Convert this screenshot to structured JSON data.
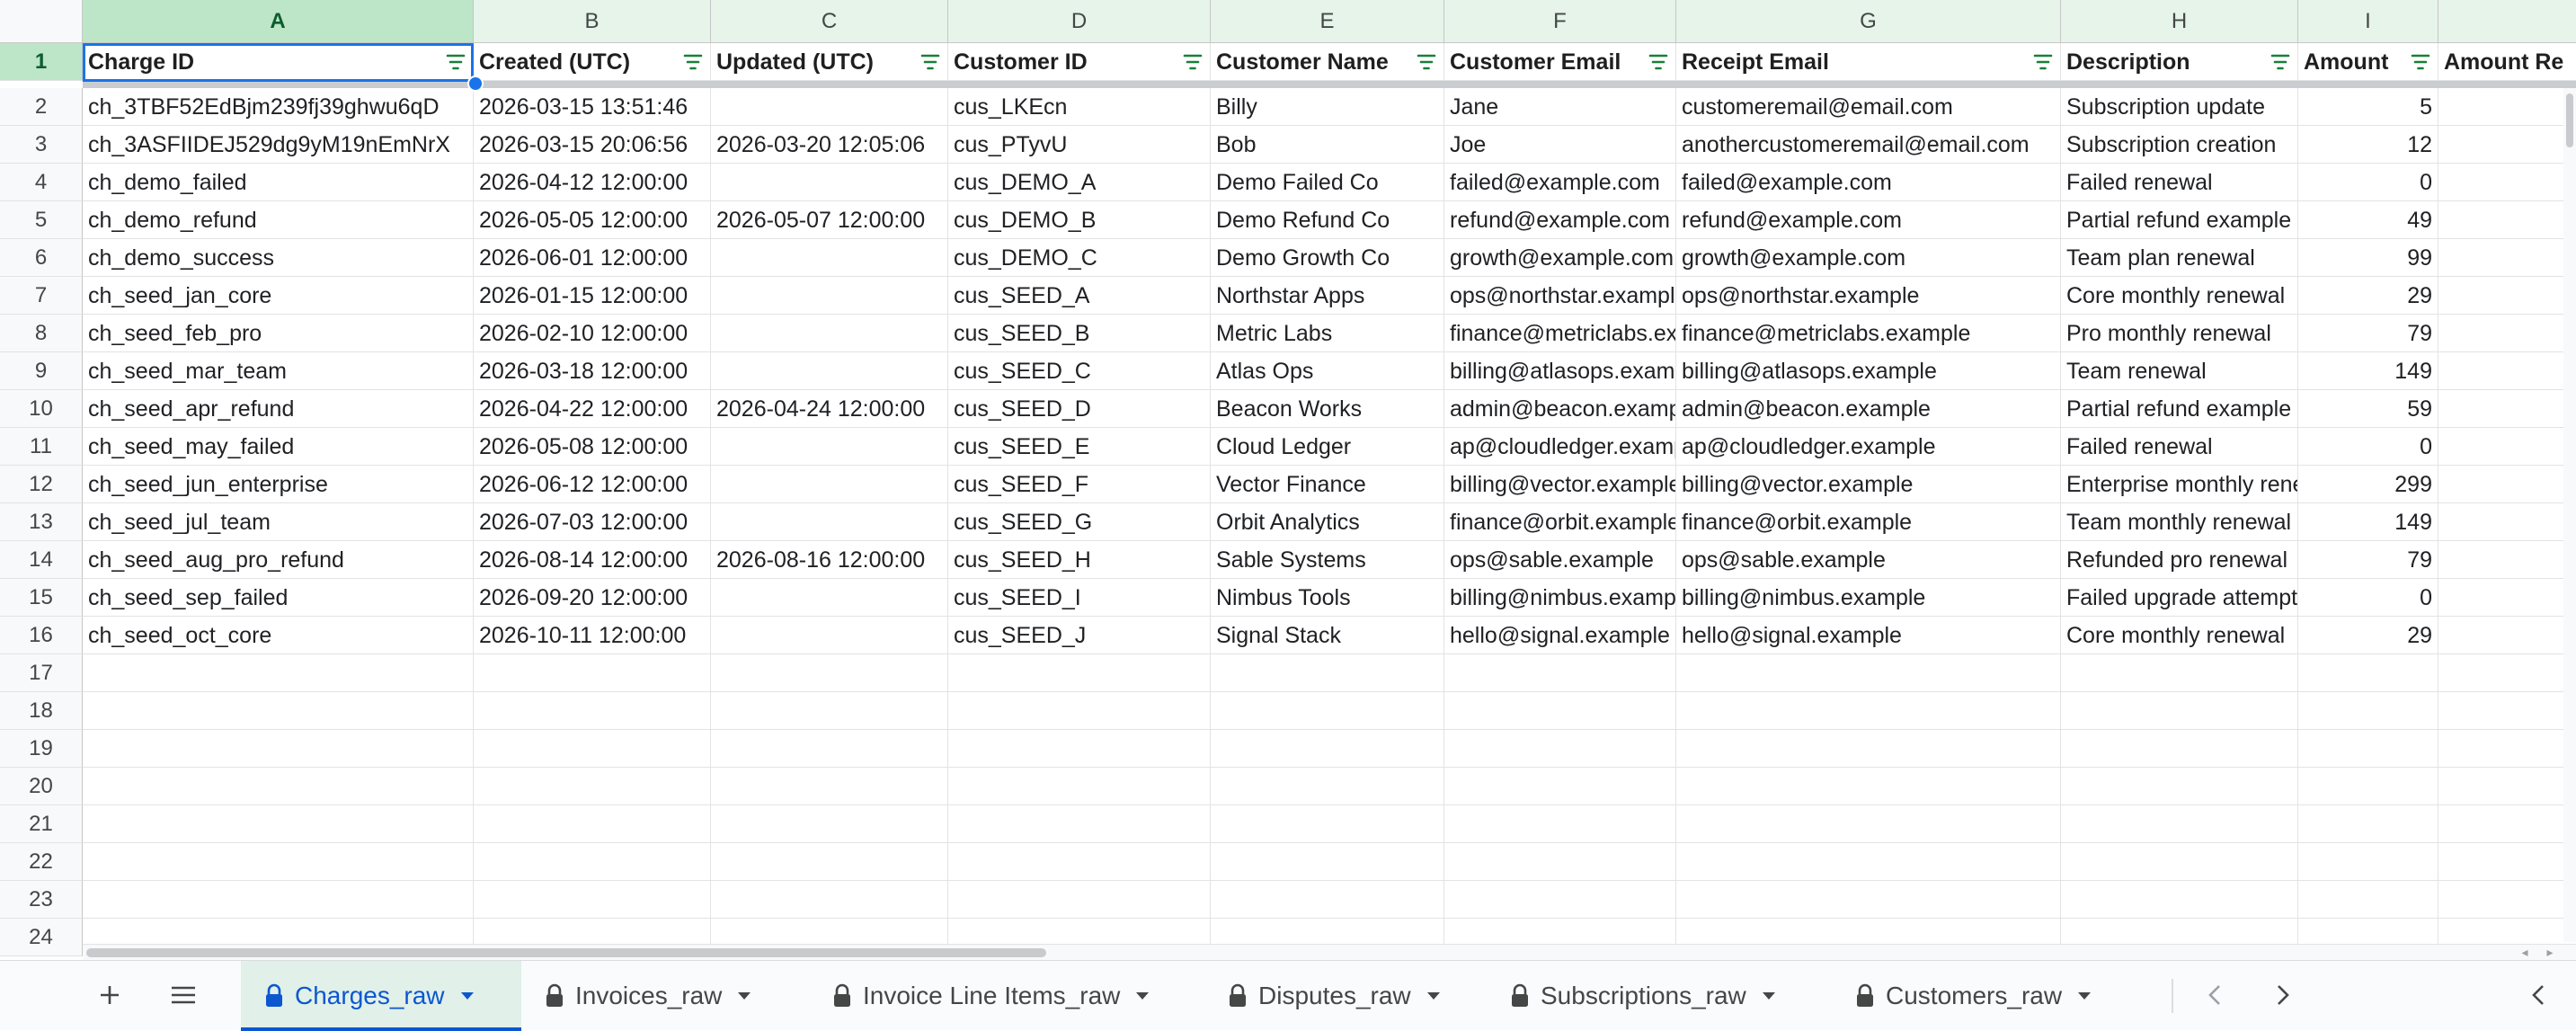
{
  "columns": [
    {
      "letter": "A",
      "header": "Charge ID"
    },
    {
      "letter": "B",
      "header": "Created (UTC)"
    },
    {
      "letter": "C",
      "header": "Updated (UTC)"
    },
    {
      "letter": "D",
      "header": "Customer ID"
    },
    {
      "letter": "E",
      "header": "Customer Name"
    },
    {
      "letter": "F",
      "header": "Customer Email"
    },
    {
      "letter": "G",
      "header": "Receipt Email"
    },
    {
      "letter": "H",
      "header": "Description"
    },
    {
      "letter": "I",
      "header": "Amount"
    },
    {
      "letter": "",
      "header": "Amount Re"
    }
  ],
  "rows": [
    [
      "ch_3TBF52EdBjm239fj39ghwu6qD",
      "2026-03-15 13:51:46",
      "",
      "cus_LKEcn",
      "Billy",
      "Jane",
      "customeremail@email.com",
      "Subscription update",
      "5",
      ""
    ],
    [
      "ch_3ASFIIDEJ529dg9yM19nEmNrX",
      "2026-03-15 20:06:56",
      "2026-03-20 12:05:06",
      "cus_PTyvU",
      "Bob",
      "Joe",
      "anothercustomeremail@email.com",
      "Subscription creation",
      "12",
      ""
    ],
    [
      "ch_demo_failed",
      "2026-04-12 12:00:00",
      "",
      "cus_DEMO_A",
      "Demo Failed Co",
      "failed@example.com",
      "failed@example.com",
      "Failed renewal",
      "0",
      ""
    ],
    [
      "ch_demo_refund",
      "2026-05-05 12:00:00",
      "2026-05-07 12:00:00",
      "cus_DEMO_B",
      "Demo Refund Co",
      "refund@example.com",
      "refund@example.com",
      "Partial refund example",
      "49",
      ""
    ],
    [
      "ch_demo_success",
      "2026-06-01 12:00:00",
      "",
      "cus_DEMO_C",
      "Demo Growth Co",
      "growth@example.com",
      "growth@example.com",
      "Team plan renewal",
      "99",
      ""
    ],
    [
      "ch_seed_jan_core",
      "2026-01-15 12:00:00",
      "",
      "cus_SEED_A",
      "Northstar Apps",
      "ops@northstar.example",
      "ops@northstar.example",
      "Core monthly renewal",
      "29",
      ""
    ],
    [
      "ch_seed_feb_pro",
      "2026-02-10 12:00:00",
      "",
      "cus_SEED_B",
      "Metric Labs",
      "finance@metriclabs.example",
      "finance@metriclabs.example",
      "Pro monthly renewal",
      "79",
      ""
    ],
    [
      "ch_seed_mar_team",
      "2026-03-18 12:00:00",
      "",
      "cus_SEED_C",
      "Atlas Ops",
      "billing@atlasops.example",
      "billing@atlasops.example",
      "Team renewal",
      "149",
      ""
    ],
    [
      "ch_seed_apr_refund",
      "2026-04-22 12:00:00",
      "2026-04-24 12:00:00",
      "cus_SEED_D",
      "Beacon Works",
      "admin@beacon.example",
      "admin@beacon.example",
      "Partial refund example",
      "59",
      ""
    ],
    [
      "ch_seed_may_failed",
      "2026-05-08 12:00:00",
      "",
      "cus_SEED_E",
      "Cloud Ledger",
      "ap@cloudledger.example",
      "ap@cloudledger.example",
      "Failed renewal",
      "0",
      ""
    ],
    [
      "ch_seed_jun_enterprise",
      "2026-06-12 12:00:00",
      "",
      "cus_SEED_F",
      "Vector Finance",
      "billing@vector.example",
      "billing@vector.example",
      "Enterprise monthly renewal",
      "299",
      ""
    ],
    [
      "ch_seed_jul_team",
      "2026-07-03 12:00:00",
      "",
      "cus_SEED_G",
      "Orbit Analytics",
      "finance@orbit.example",
      "finance@orbit.example",
      "Team monthly renewal",
      "149",
      ""
    ],
    [
      "ch_seed_aug_pro_refund",
      "2026-08-14 12:00:00",
      "2026-08-16 12:00:00",
      "cus_SEED_H",
      "Sable Systems",
      "ops@sable.example",
      "ops@sable.example",
      "Refunded pro renewal",
      "79",
      ""
    ],
    [
      "ch_seed_sep_failed",
      "2026-09-20 12:00:00",
      "",
      "cus_SEED_I",
      "Nimbus Tools",
      "billing@nimbus.example",
      "billing@nimbus.example",
      "Failed upgrade attempt",
      "0",
      ""
    ],
    [
      "ch_seed_oct_core",
      "2026-10-11 12:00:00",
      "",
      "cus_SEED_J",
      "Signal Stack",
      "hello@signal.example",
      "hello@signal.example",
      "Core monthly renewal",
      "29",
      ""
    ]
  ],
  "row_numbers": [
    "1",
    "2",
    "3",
    "4",
    "5",
    "6",
    "7",
    "8",
    "9",
    "10",
    "11",
    "12",
    "13",
    "14",
    "15",
    "16",
    "17",
    "18",
    "19",
    "20",
    "21",
    "22",
    "23",
    "24"
  ],
  "sheet_tabs": [
    {
      "label": "Charges_raw",
      "active": true,
      "locked": true
    },
    {
      "label": "Invoices_raw",
      "active": false,
      "locked": true
    },
    {
      "label": "Invoice Line Items_raw",
      "active": false,
      "locked": true
    },
    {
      "label": "Disputes_raw",
      "active": false,
      "locked": true
    },
    {
      "label": "Subscriptions_raw",
      "active": false,
      "locked": true
    },
    {
      "label": "Customers_raw",
      "active": false,
      "locked": true
    }
  ],
  "selected_cell": "A1",
  "colors": {
    "header_green": "#e6f4ea",
    "selected_header": "#bde5c8",
    "accent_blue": "#1a73e8",
    "active_tab_text": "#0b57d0",
    "filter_icon": "#188038"
  },
  "icons": {
    "add_sheet": "plus-icon",
    "all_sheets": "menu-icon",
    "tab_lock": "lock-icon",
    "tab_menu": "caret-down-icon",
    "filter": "filter-icon",
    "prev": "chevron-left-icon",
    "next": "chevron-right-icon",
    "side_panel": "chevron-left-icon"
  }
}
